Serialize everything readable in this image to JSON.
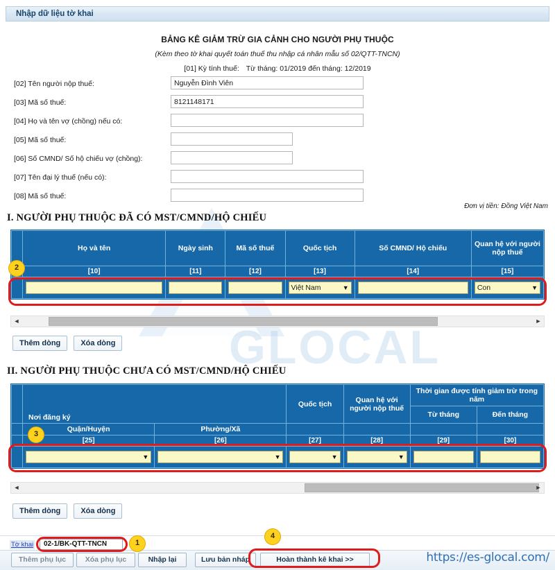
{
  "window": {
    "title": "Nhập dữ liệu tờ khai"
  },
  "document": {
    "title": "BẢNG KÊ GIẢM TRỪ GIA CẢNH CHO NGƯỜI PHỤ THUỘC",
    "subtitle": "(Kèm theo tờ khai quyết toán thuế thu nhập cá nhân mẫu số 02/QTT-TNCN)",
    "period_label": "[01] Kỳ tính thuế:",
    "period_value": "Từ tháng: 01/2019 đến tháng: 12/2019",
    "currency_note": "Đơn vị tiền: Đồng Việt Nam"
  },
  "fields": [
    {
      "label": "[02] Tên người nộp thuế:",
      "value": "Nguyễn Đình Viên",
      "placeholder": "",
      "width": "wide"
    },
    {
      "label": "[03] Mã số thuế:",
      "value": "8121148171",
      "placeholder": "",
      "width": "wide"
    },
    {
      "label": "[04] Họ và tên vợ (chồng) nếu có:",
      "value": "",
      "placeholder": "",
      "width": "wide"
    },
    {
      "label": "[05] Mã số thuế:",
      "value": "",
      "placeholder": "",
      "width": "narrow"
    },
    {
      "label": "[06] Số CMND/ Số hộ chiếu vợ (chồng):",
      "value": "",
      "placeholder": "",
      "width": "narrow"
    },
    {
      "label": "[07] Tên đại lý thuế (nếu có):",
      "value": "",
      "placeholder": "",
      "width": "wide"
    },
    {
      "label": "[08] Mã số thuế:",
      "value": "",
      "placeholder": "",
      "width": "wide"
    }
  ],
  "section1": {
    "heading": "I. NGƯỜI PHỤ THUỘC ĐÃ CÓ MST/CMND/HỘ CHIẾU",
    "columns": [
      {
        "label": "Họ và tên",
        "code": "[10]"
      },
      {
        "label": "Ngày sinh",
        "code": "[11]"
      },
      {
        "label": "Mã số thuế",
        "code": "[12]"
      },
      {
        "label": "Quốc tịch",
        "code": "[13]"
      },
      {
        "label": "Số CMND/ Hộ chiếu",
        "code": "[14]"
      },
      {
        "label": "Quan hệ với người nộp thuế",
        "code": "[15]"
      }
    ],
    "row": {
      "index": "",
      "ho_va_ten": "",
      "ngay_sinh": "",
      "ma_so_thue": "",
      "quoc_tich": "Việt Nam",
      "so_cmnd": "",
      "quan_he": "Con"
    },
    "buttons": {
      "add": "Thêm dòng",
      "remove": "Xóa dòng"
    },
    "scroll": {
      "left_arrow": "◄",
      "right_arrow": "►",
      "thumb_start_pct": 6,
      "thumb_width_pct": 73
    }
  },
  "section2": {
    "heading": "II. NGƯỜI PHỤ THUỘC CHƯA CÓ MST/CMND/HỘ CHIẾU",
    "group_noi_dang_ky": "Nơi đăng ký",
    "group_thoi_gian": "Thời gian được tính giảm trừ trong năm",
    "columns": [
      {
        "label": "Quận/Huyện",
        "code": "[25]"
      },
      {
        "label": "Phường/Xã",
        "code": "[26]"
      },
      {
        "label": "Quốc tịch",
        "code": "[27]"
      },
      {
        "label": "Quan hệ với người nộp thuế",
        "code": "[28]"
      },
      {
        "label": "Từ tháng",
        "code": "[29]"
      },
      {
        "label": "Đến tháng",
        "code": "[30]"
      }
    ],
    "row": {
      "index": "",
      "quan_huyen": "",
      "phuong_xa": "",
      "quoc_tich": "",
      "quan_he": "",
      "tu_thang": "",
      "den_thang": ""
    },
    "buttons": {
      "add": "Thêm dòng",
      "remove": "Xóa dòng"
    },
    "scroll": {
      "left_arrow": "◄",
      "right_arrow": "►",
      "thumb_start_pct": 54,
      "thumb_width_pct": 44
    }
  },
  "footer": {
    "to_khai_label": "Tờ khai",
    "to_khai_code": "02-1/BK-QTT-TNCN",
    "buttons": {
      "them_phu_luc": "Thêm phụ lục",
      "xoa_phu_luc": "Xóa phụ lục",
      "nhap_lai": "Nhập lại",
      "luu_ban_nhap": "Lưu bản nháp",
      "hoan_thanh": "Hoàn thành kê khai >>"
    },
    "url": "https://es-glocal.com/"
  },
  "badges": [
    {
      "number": "1"
    },
    {
      "number": "2"
    },
    {
      "number": "3"
    },
    {
      "number": "4"
    }
  ],
  "colors": {
    "header_blue": "#1668A8",
    "grid_line": "#6FB3DE",
    "input_yellow": "#FBF8C8",
    "highlight_red": "#E01B1B",
    "badge_yellow": "#FFD21F",
    "url_blue": "#2F6FB5"
  },
  "watermark": {
    "text": "GLOCAL"
  }
}
